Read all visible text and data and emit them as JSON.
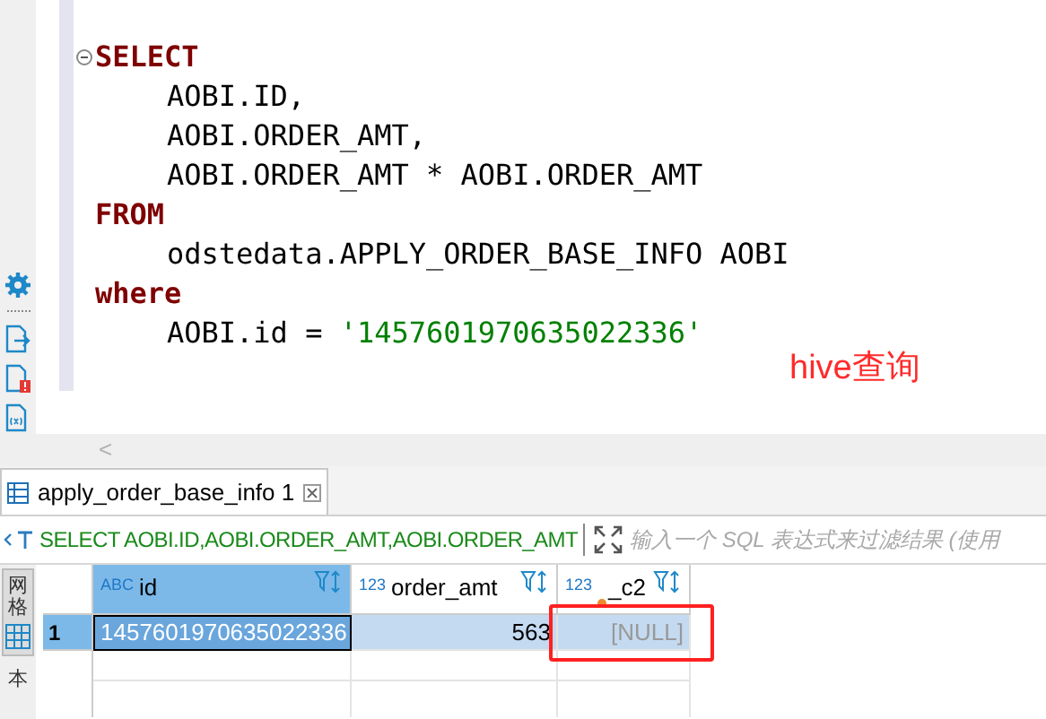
{
  "left_toolbar": {
    "items": [
      {
        "kind": "gear"
      },
      {
        "kind": "separator"
      },
      {
        "kind": "export"
      },
      {
        "kind": "warning"
      },
      {
        "kind": "variable"
      }
    ]
  },
  "editor": {
    "lines": [
      {
        "kind": "fold_start",
        "tokens": [
          {
            "kind": "keyword",
            "text": "SELECT"
          }
        ]
      },
      {
        "kind": "body",
        "tokens": [
          {
            "kind": "plain",
            "text": "AOBI.ID,"
          }
        ]
      },
      {
        "kind": "body",
        "tokens": [
          {
            "kind": "plain",
            "text": "AOBI.ORDER_AMT,"
          }
        ]
      },
      {
        "kind": "body",
        "tokens": [
          {
            "kind": "plain",
            "text": "AOBI.ORDER_AMT * AOBI.ORDER_AMT"
          }
        ]
      },
      {
        "kind": "clause",
        "tokens": [
          {
            "kind": "keyword",
            "text": "FROM"
          }
        ]
      },
      {
        "kind": "body",
        "tokens": [
          {
            "kind": "plain",
            "text": "odstedata.APPLY_ORDER_BASE_INFO AOBI"
          }
        ]
      },
      {
        "kind": "clause",
        "tokens": [
          {
            "kind": "keyword",
            "text": "where"
          }
        ]
      },
      {
        "kind": "body",
        "tokens": [
          {
            "kind": "plain",
            "text": "AOBI.id = "
          },
          {
            "kind": "string",
            "text": "'1457601970635022336'"
          }
        ]
      }
    ],
    "scroll_left": "<"
  },
  "annotation_text": "hive查询",
  "results_tab": {
    "label": "apply_order_base_info 1",
    "selected": true
  },
  "filter_bar": {
    "query": "SELECT AOBI.ID,AOBI.ORDER_AMT,AOBI.ORDER_AMT",
    "placeholder": "输入一个 SQL 表达式来过滤结果 (使用"
  },
  "side_tabs": [
    {
      "label": "网格",
      "selected": true
    },
    {
      "label": "本",
      "selected": false
    }
  ],
  "grid": {
    "columns": [
      {
        "type_label": "ABC",
        "name": "id",
        "selected": true,
        "highlighted": false
      },
      {
        "type_label": "123",
        "name": "order_amt",
        "selected": false,
        "highlighted": false
      },
      {
        "type_label": "123",
        "name": "_c2",
        "selected": false,
        "highlighted": true
      }
    ],
    "rows": [
      {
        "number": "1",
        "selected": true,
        "cells": [
          {
            "kind": "text",
            "text": "1457601970635022336",
            "focused": true
          },
          {
            "kind": "number",
            "text": "563",
            "focused": false
          },
          {
            "kind": "null",
            "text": "[NULL]",
            "focused": false
          }
        ]
      }
    ]
  }
}
